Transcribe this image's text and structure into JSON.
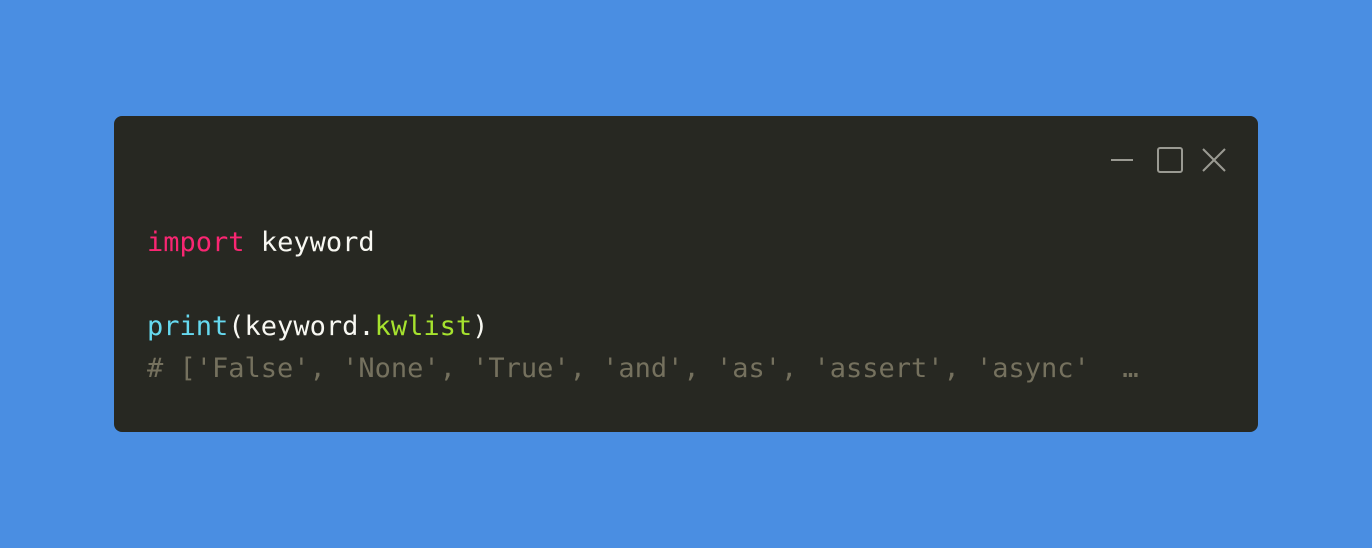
{
  "colors": {
    "background": "#4a8ee2",
    "window": "#272822",
    "keyword": "#f92672",
    "builtin": "#66d9ef",
    "attribute": "#a6e22e",
    "comment": "#75715e",
    "text": "#f8f8f2",
    "controls": "#9a9a92"
  },
  "window_controls": {
    "minimize_icon": "minimize-icon",
    "maximize_icon": "maximize-icon",
    "close_icon": "close-icon"
  },
  "code": {
    "line1": {
      "keyword": "import",
      "module": "keyword"
    },
    "line3": {
      "func": "print",
      "open_paren": "(",
      "obj": "keyword",
      "dot": ".",
      "attr": "kwlist",
      "close_paren": ")"
    },
    "line4": {
      "comment": "# ['False', 'None', 'True', 'and', 'as', 'assert', 'async'  …"
    }
  }
}
